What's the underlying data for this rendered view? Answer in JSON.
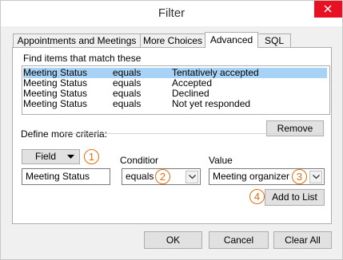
{
  "window": {
    "title": "Filter"
  },
  "tabs": [
    {
      "label": "Appointments and Meetings",
      "active": false
    },
    {
      "label": "More Choices",
      "active": false
    },
    {
      "label": "Advanced",
      "active": true
    },
    {
      "label": "SQL",
      "active": false
    }
  ],
  "advanced": {
    "find_label": "Find items that match these",
    "criteria": [
      {
        "field": "Meeting Status",
        "condition": "equals",
        "value": "Tentatively accepted",
        "selected": true
      },
      {
        "field": "Meeting Status",
        "condition": "equals",
        "value": "Accepted",
        "selected": false
      },
      {
        "field": "Meeting Status",
        "condition": "equals",
        "value": "Declined",
        "selected": false
      },
      {
        "field": "Meeting Status",
        "condition": "equals",
        "value": "Not yet responded",
        "selected": false
      }
    ],
    "remove_label": "Remove",
    "define_label": "Define more criteria:",
    "field_button_label": "Field",
    "condition_label": "Conditior",
    "value_label": "Value",
    "field_value": "Meeting Status",
    "condition_value": "equals",
    "value_value": "Meeting organizer",
    "add_button_label": "Add to List",
    "callouts": [
      "1",
      "2",
      "3",
      "4"
    ]
  },
  "buttons": {
    "ok": "OK",
    "cancel": "Cancel",
    "clear": "Clear All"
  },
  "colors": {
    "selection": "#a6d2f5",
    "callout": "#e46c0a",
    "close": "#e81123"
  }
}
